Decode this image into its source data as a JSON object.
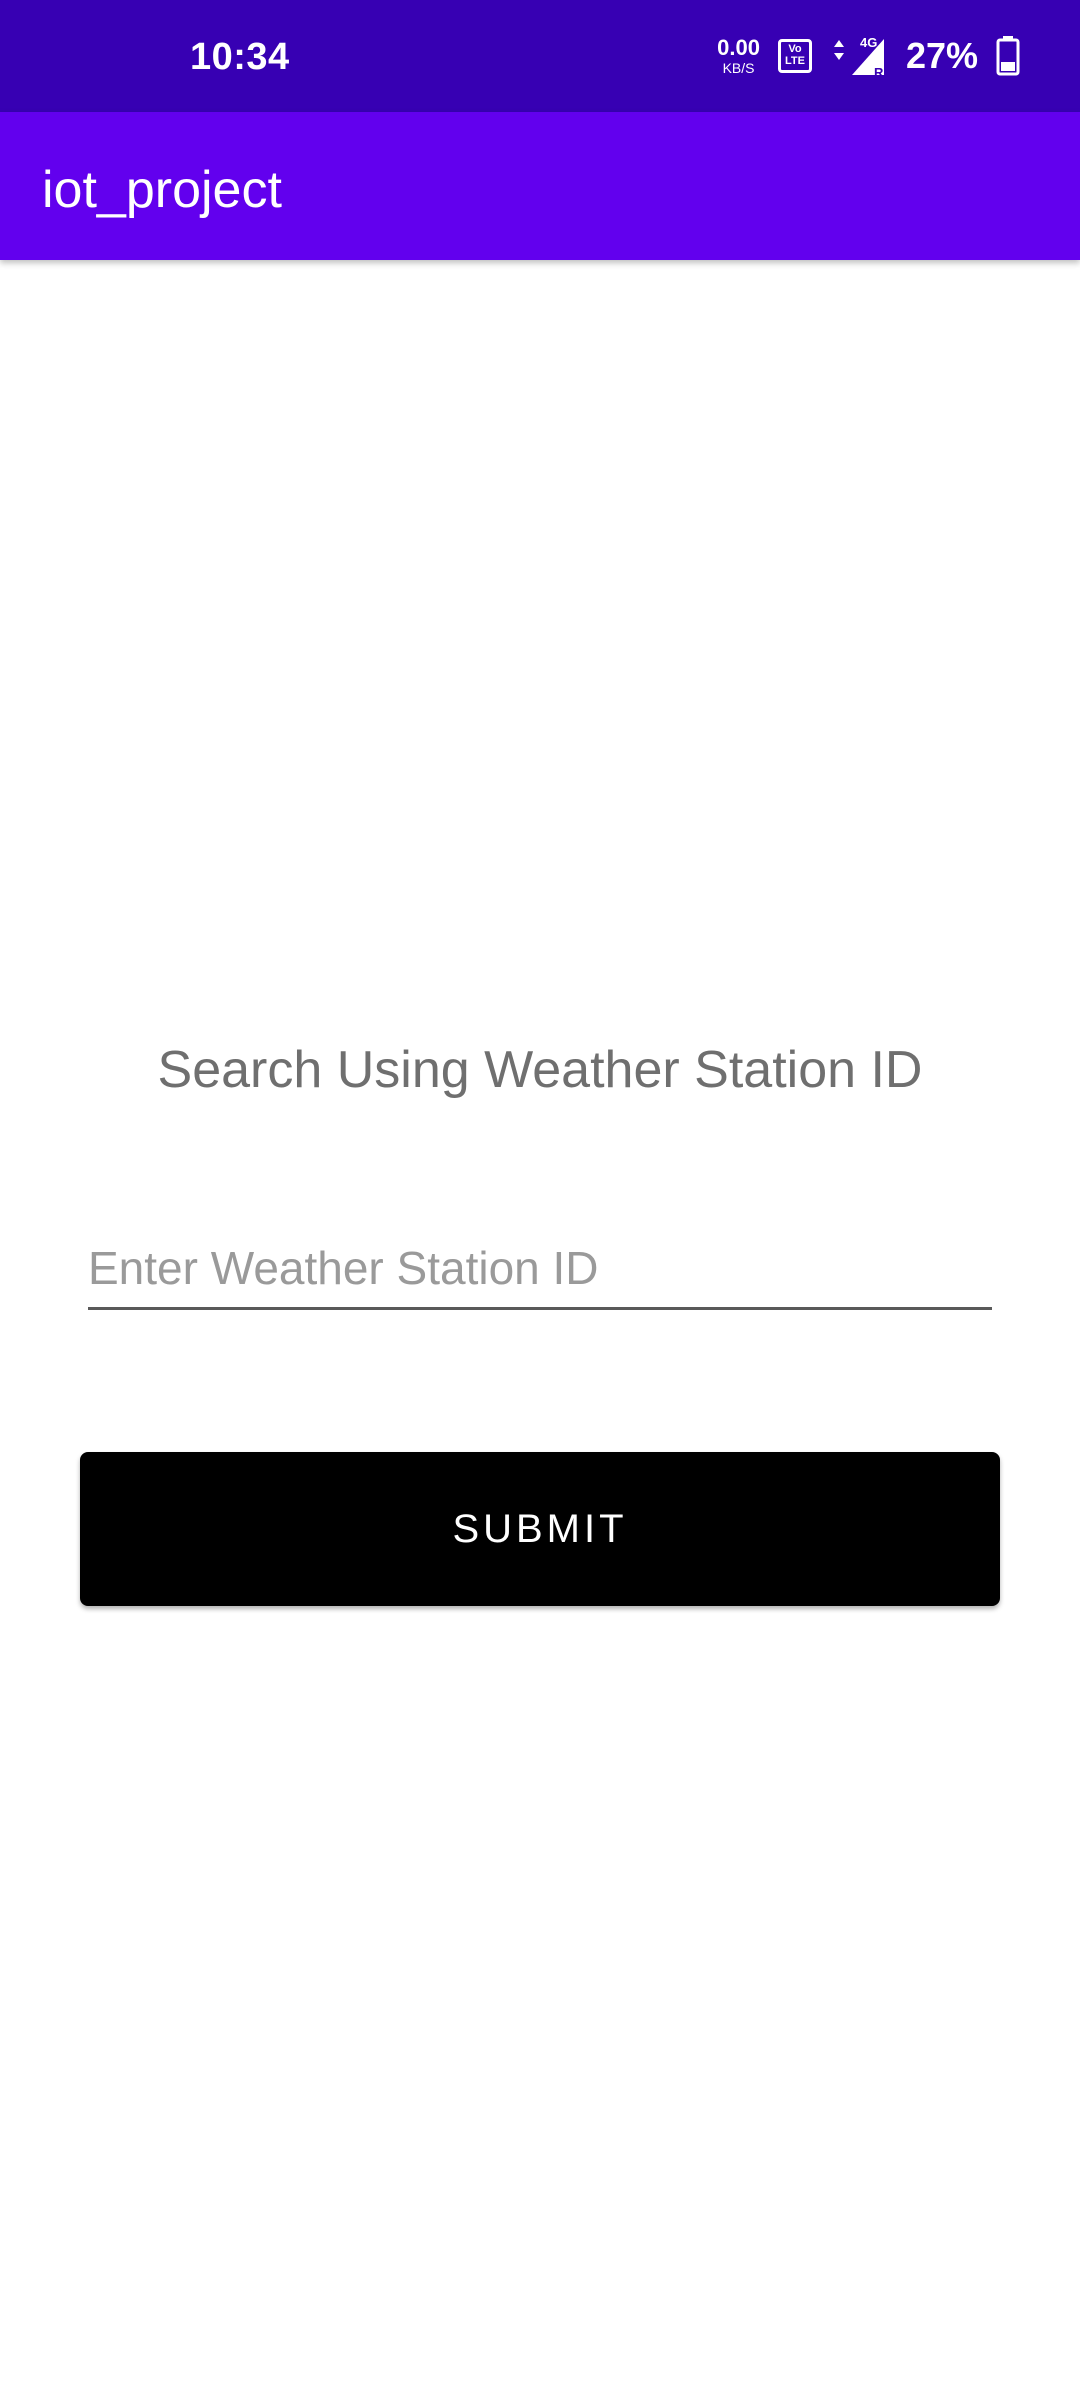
{
  "status_bar": {
    "time": "10:34",
    "net_speed_value": "0.00",
    "net_speed_unit": "KB/S",
    "volte_line1": "Vo",
    "volte_line2": "LTE",
    "network_type": "4G",
    "roaming": "R",
    "battery_percent": "27%",
    "icons": [
      "volte-icon",
      "data-arrows-icon",
      "signal-icon",
      "battery-icon"
    ]
  },
  "app_bar": {
    "title": "iot_project"
  },
  "main": {
    "heading": "Search Using Weather Station ID",
    "input_placeholder": "Enter Weather Station ID",
    "input_value": "",
    "submit_label": "SUBMIT"
  },
  "colors": {
    "status_bar": "#3700B3",
    "app_bar": "#6200EE",
    "button": "#000000",
    "heading_text": "#6F6F6F"
  }
}
